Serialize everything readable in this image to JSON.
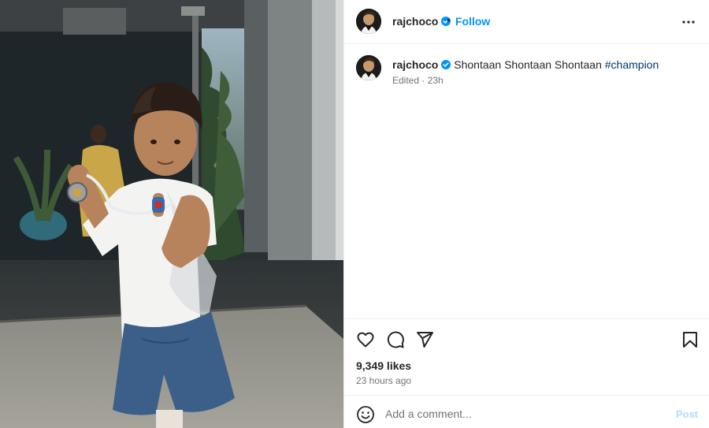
{
  "header": {
    "username": "rajchoco",
    "separator": "•",
    "follow_label": "Follow"
  },
  "caption": {
    "username": "rajchoco",
    "text": "Shontaan Shontaan Shontaan",
    "hashtag": "#champion",
    "edited": "Edited · 23h"
  },
  "stats": {
    "likes": "9,349 likes",
    "posted": "23 hours ago"
  },
  "comment": {
    "placeholder": "Add a comment...",
    "post_label": "Post"
  },
  "colors": {
    "accent": "#0095f6",
    "verified": "#0095f6",
    "hashtag": "#00376b",
    "post_disabled": "#b3dbff"
  },
  "icons": [
    "verified-badge-icon",
    "more-options-icon",
    "heart-icon",
    "comment-icon",
    "share-icon",
    "save-icon",
    "emoji-icon"
  ]
}
